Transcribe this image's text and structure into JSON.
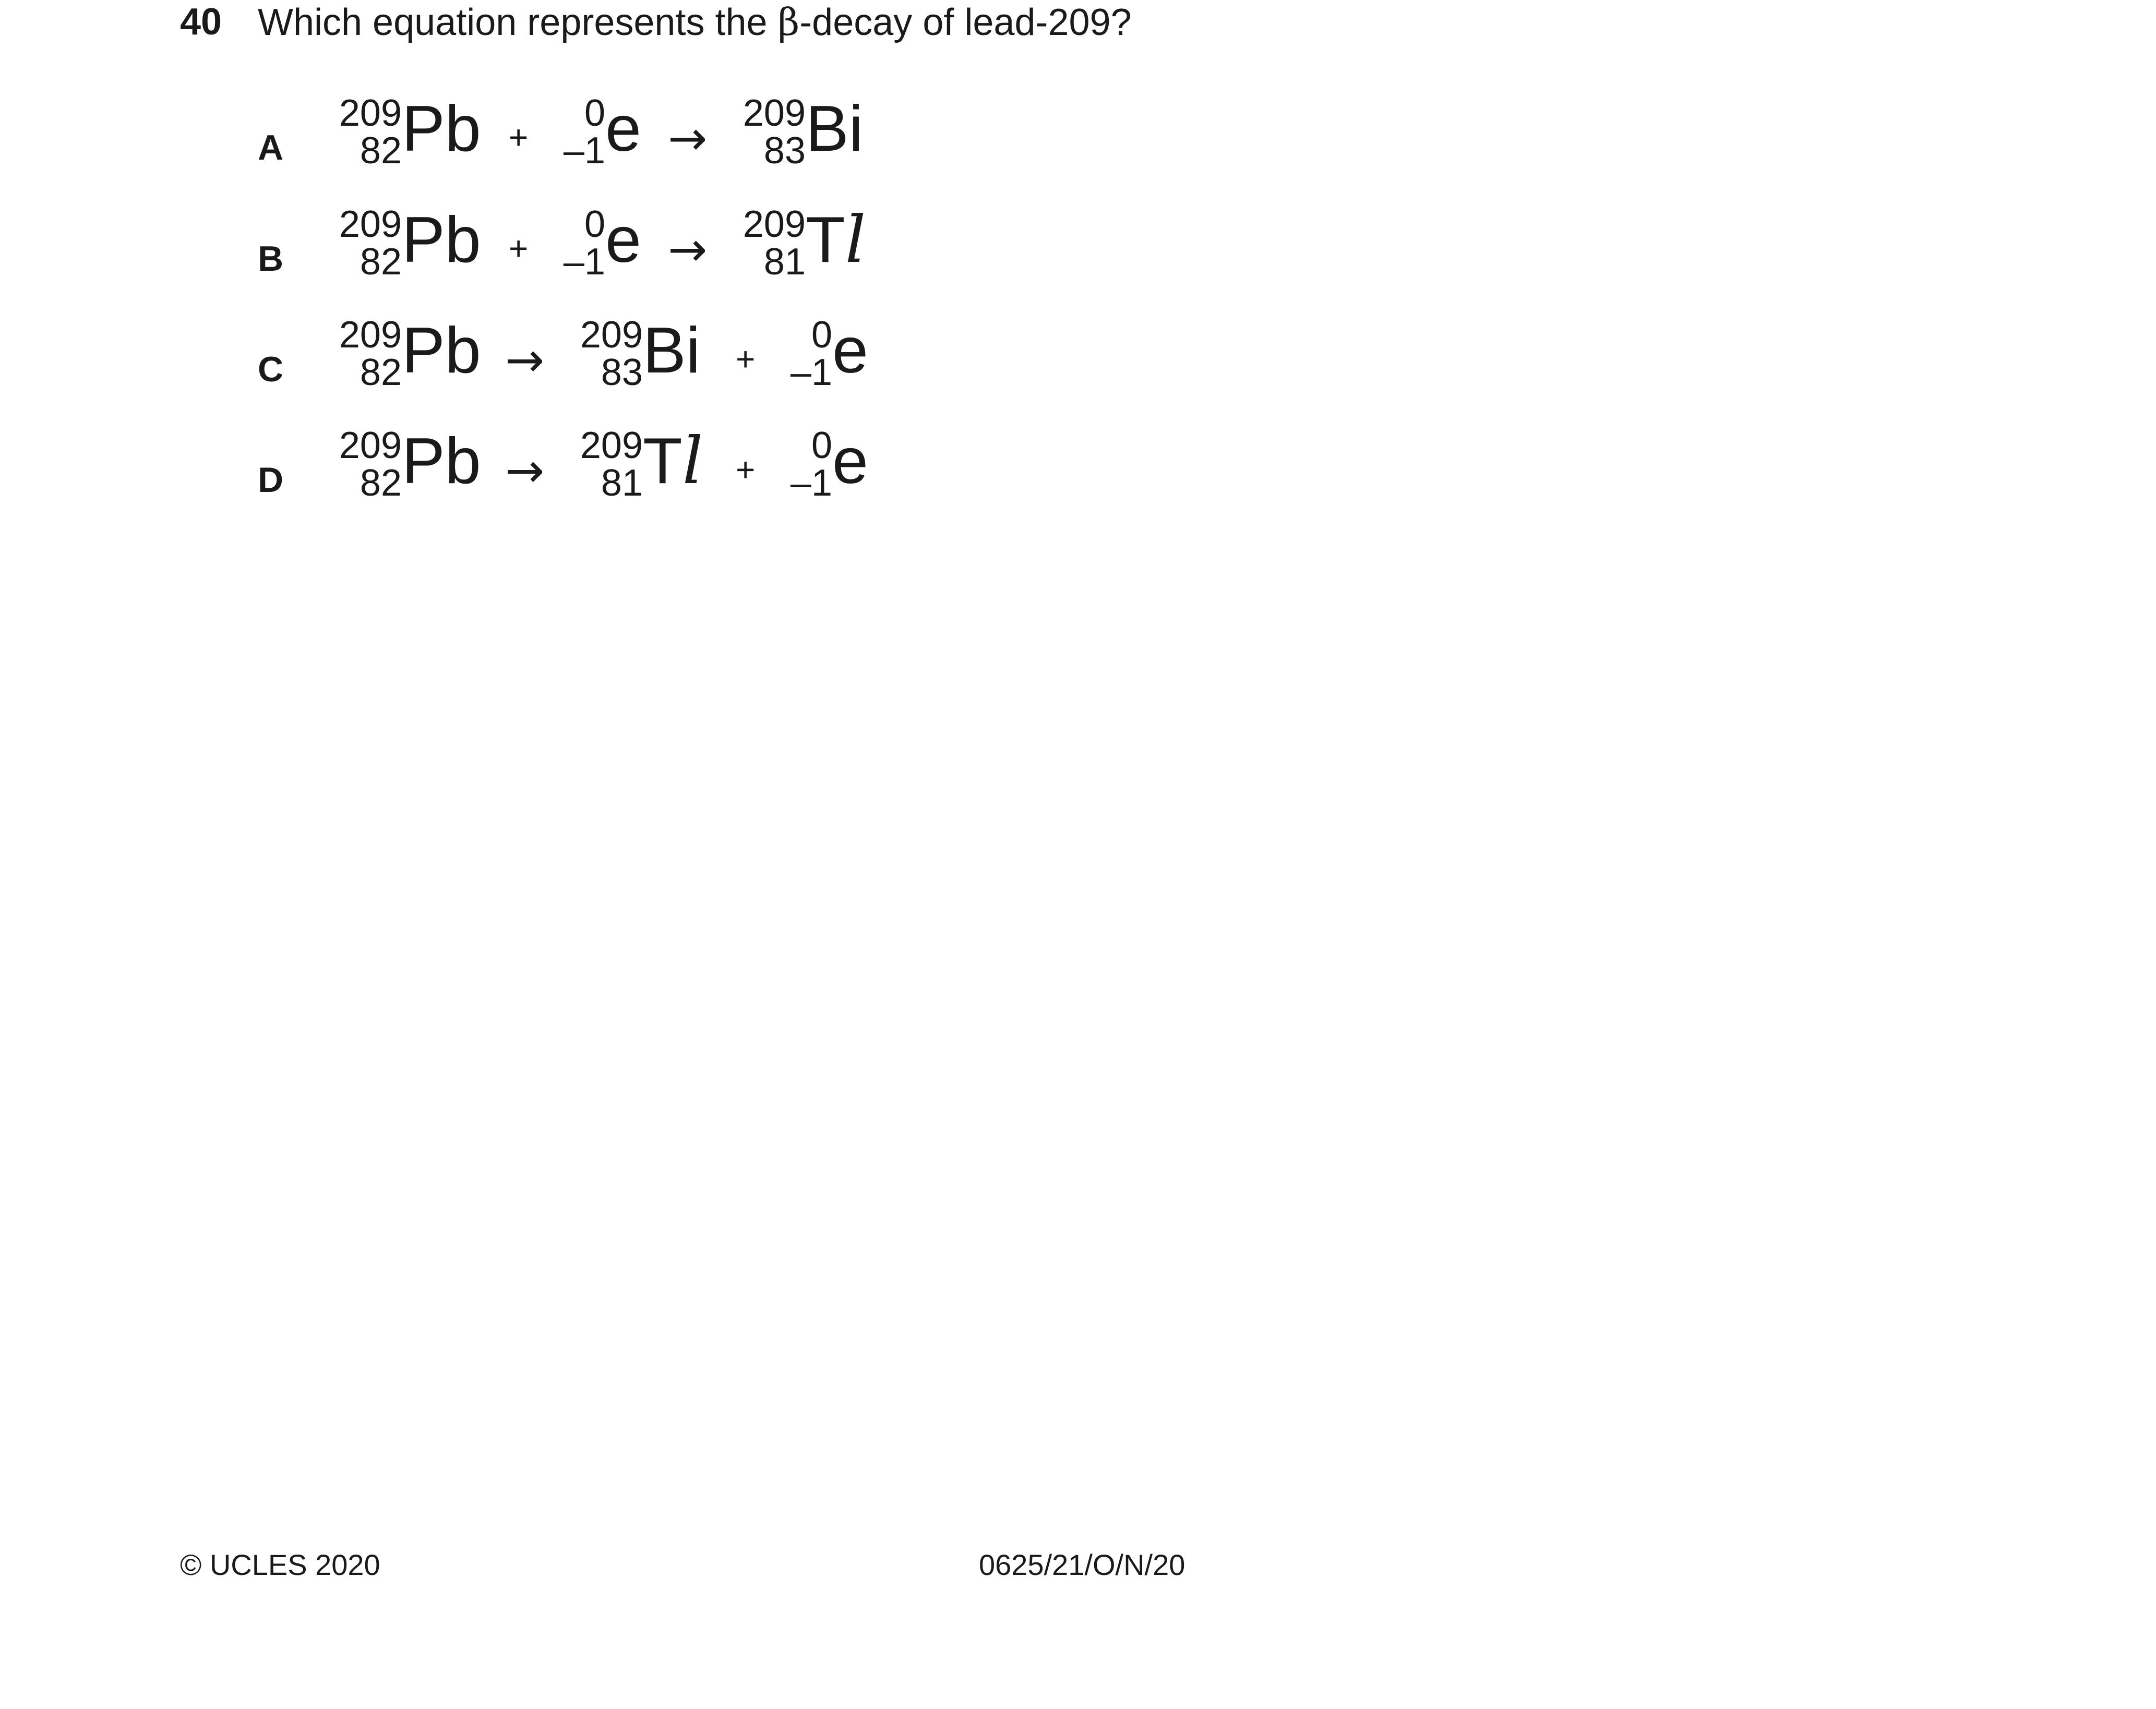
{
  "question": {
    "number": "40",
    "text_before": "Which equation represents the ",
    "beta_symbol": "β",
    "text_after": "-decay of lead-209?"
  },
  "options": [
    {
      "letter": "A",
      "nuclides": [
        {
          "mass": "209",
          "atomic": "82",
          "symbol": "Pb"
        },
        {
          "mass": "0",
          "atomic": "–1",
          "symbol": "e"
        },
        {
          "mass": "209",
          "atomic": "83",
          "symbol": "Bi"
        }
      ],
      "operators": [
        "+",
        "→"
      ]
    },
    {
      "letter": "B",
      "nuclides": [
        {
          "mass": "209",
          "atomic": "82",
          "symbol": "Pb"
        },
        {
          "mass": "0",
          "atomic": "–1",
          "symbol": "e"
        },
        {
          "mass": "209",
          "atomic": "81",
          "symbol": "T",
          "symbol_suffix": "l"
        }
      ],
      "operators": [
        "+",
        "→"
      ]
    },
    {
      "letter": "C",
      "nuclides": [
        {
          "mass": "209",
          "atomic": "82",
          "symbol": "Pb"
        },
        {
          "mass": "209",
          "atomic": "83",
          "symbol": "Bi"
        },
        {
          "mass": "0",
          "atomic": "–1",
          "symbol": "e"
        }
      ],
      "operators": [
        "→",
        "+"
      ]
    },
    {
      "letter": "D",
      "nuclides": [
        {
          "mass": "209",
          "atomic": "82",
          "symbol": "Pb"
        },
        {
          "mass": "209",
          "atomic": "81",
          "symbol": "T",
          "symbol_suffix": "l"
        },
        {
          "mass": "0",
          "atomic": "–1",
          "symbol": "e"
        }
      ],
      "operators": [
        "→",
        "+"
      ]
    }
  ],
  "footer": {
    "copyright": "© UCLES 2020",
    "paper_code": "0625/21/O/N/20"
  }
}
